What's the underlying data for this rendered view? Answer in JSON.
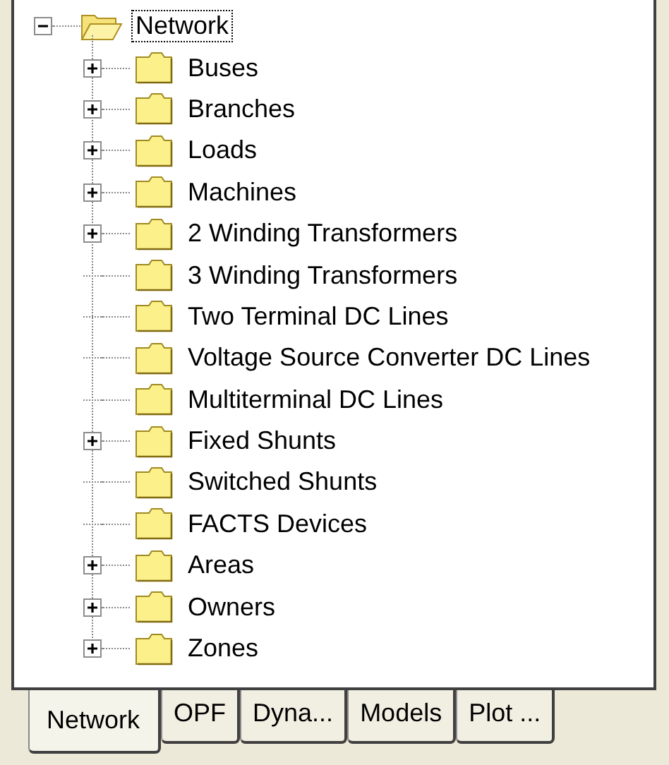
{
  "tree": {
    "label": "Network",
    "expanded": true,
    "selected": true,
    "children": [
      {
        "label": "Buses",
        "expandable": true
      },
      {
        "label": "Branches",
        "expandable": true
      },
      {
        "label": "Loads",
        "expandable": true
      },
      {
        "label": "Machines",
        "expandable": true
      },
      {
        "label": "2 Winding Transformers",
        "expandable": true
      },
      {
        "label": "3 Winding Transformers",
        "expandable": false
      },
      {
        "label": "Two Terminal DC Lines",
        "expandable": false
      },
      {
        "label": "Voltage Source Converter DC Lines",
        "expandable": false
      },
      {
        "label": "Multiterminal DC Lines",
        "expandable": false
      },
      {
        "label": "Fixed Shunts",
        "expandable": true
      },
      {
        "label": "Switched Shunts",
        "expandable": false
      },
      {
        "label": "FACTS Devices",
        "expandable": false
      },
      {
        "label": "Areas",
        "expandable": true
      },
      {
        "label": "Owners",
        "expandable": true
      },
      {
        "label": "Zones",
        "expandable": true
      }
    ]
  },
  "tabs": [
    {
      "label": "Network",
      "selected": true
    },
    {
      "label": "OPF",
      "selected": false
    },
    {
      "label": "Dyna...",
      "selected": false
    },
    {
      "label": "Models",
      "selected": false
    },
    {
      "label": "Plot ...",
      "selected": false
    }
  ]
}
